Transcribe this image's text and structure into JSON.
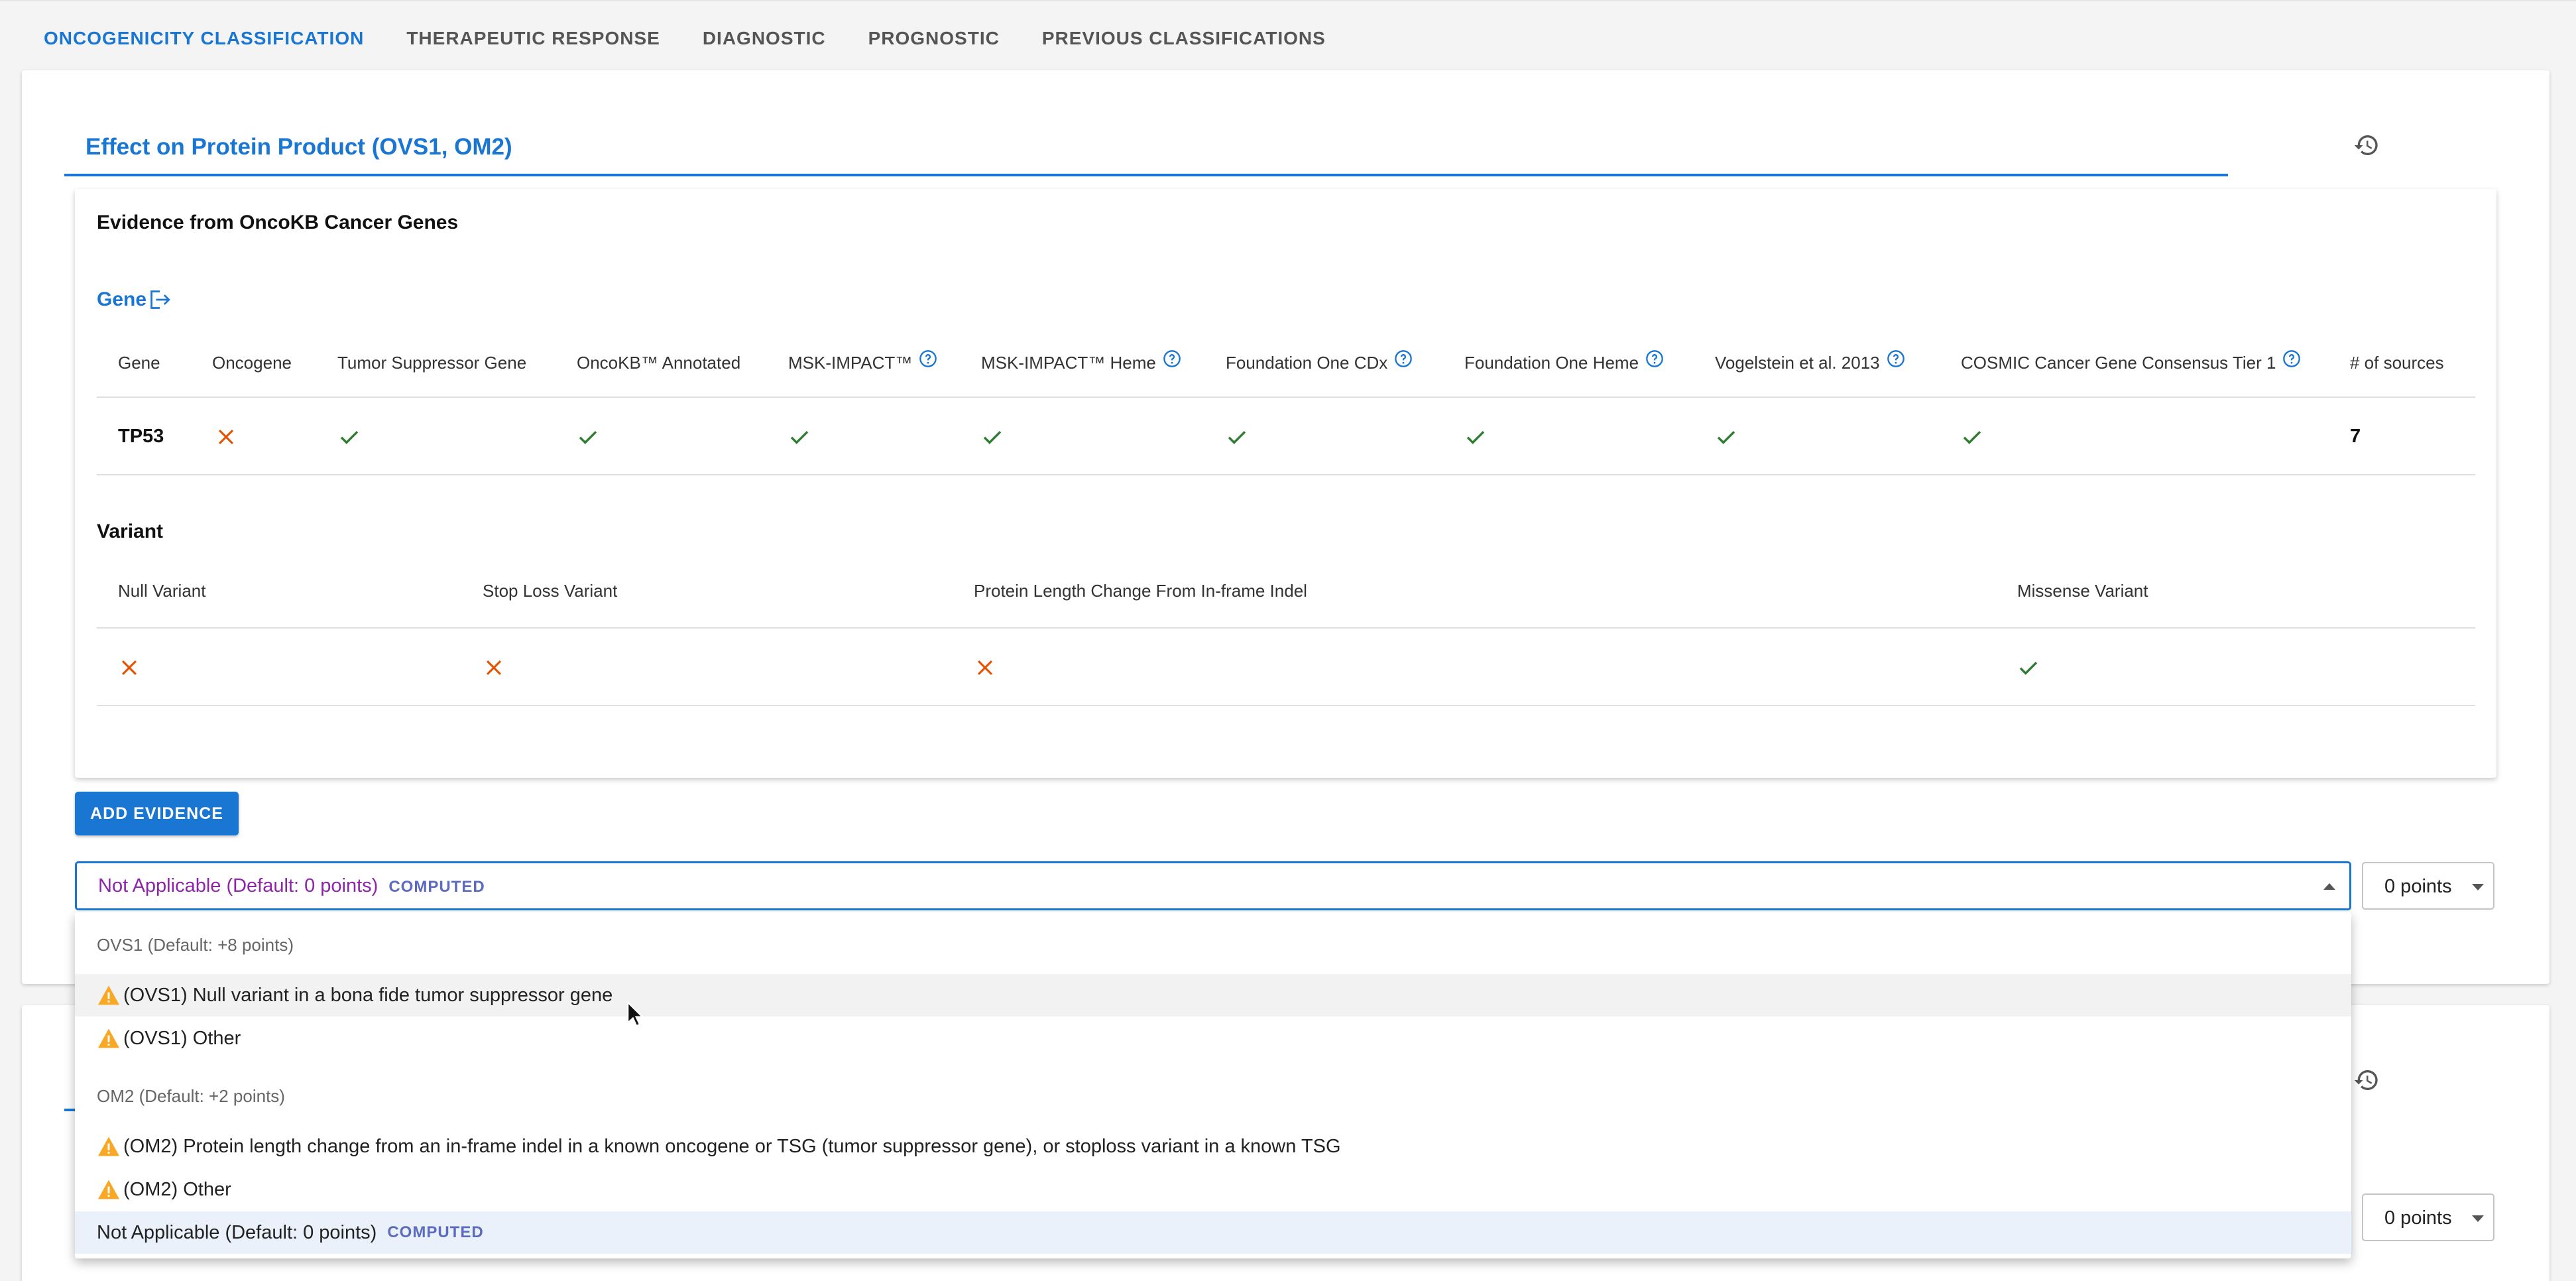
{
  "tabs": [
    {
      "label": "ONCOGENICITY CLASSIFICATION",
      "active": true
    },
    {
      "label": "THERAPEUTIC RESPONSE",
      "active": false
    },
    {
      "label": "DIAGNOSTIC",
      "active": false
    },
    {
      "label": "PROGNOSTIC",
      "active": false
    },
    {
      "label": "PREVIOUS CLASSIFICATIONS",
      "active": false
    }
  ],
  "section": {
    "title": "Effect on Protein Product (OVS1, OM2)",
    "history_icon": "history-icon"
  },
  "evidence": {
    "heading": "Evidence from OncoKB Cancer Genes",
    "gene_link": "Gene",
    "gene_table": {
      "headers": [
        "Gene",
        "Oncogene",
        "Tumor Suppressor Gene",
        "OncoKB™ Annotated",
        "MSK-IMPACT™",
        "MSK-IMPACT™ Heme",
        "Foundation One CDx",
        "Foundation One Heme",
        "Vogelstein et al. 2013",
        "COSMIC Cancer Gene Consensus Tier 1",
        "# of sources"
      ],
      "row": {
        "gene": "TP53",
        "marks": [
          "cross",
          "check",
          "check",
          "check",
          "check",
          "check",
          "check",
          "check",
          "check"
        ],
        "sources": "7"
      }
    },
    "variant_heading": "Variant",
    "variant_table": {
      "headers": [
        "Null Variant",
        "Stop Loss Variant",
        "Protein Length Change From In-frame Indel",
        "Missense Variant"
      ],
      "marks": [
        "cross",
        "cross",
        "cross",
        "check"
      ]
    }
  },
  "add_evidence_label": "ADD EVIDENCE",
  "select": {
    "value": "Not Applicable (Default: 0 points)",
    "computed": "COMPUTED",
    "points": "0 points"
  },
  "dropdown": {
    "group1": "OVS1 (Default: +8 points)",
    "item1": "(OVS1) Null variant in a bona fide tumor suppressor gene",
    "item2": "(OVS1) Other",
    "group2": "OM2 (Default: +2 points)",
    "item3": "(OM2) Protein length change from an in-frame indel in a known oncogene or TSG (tumor suppressor gene), or stoploss variant in a known TSG",
    "item4": "(OM2) Other",
    "item5": "Not Applicable (Default: 0 points)",
    "item5_computed": "COMPUTED"
  },
  "second_section": {
    "points": "0 points"
  },
  "colors": {
    "primary": "#1976d2",
    "check": "#2e7d32",
    "cross": "#e65100",
    "warning": "#f9a825",
    "selected_value": "#8e24aa",
    "computed": "#5c6bc0"
  }
}
